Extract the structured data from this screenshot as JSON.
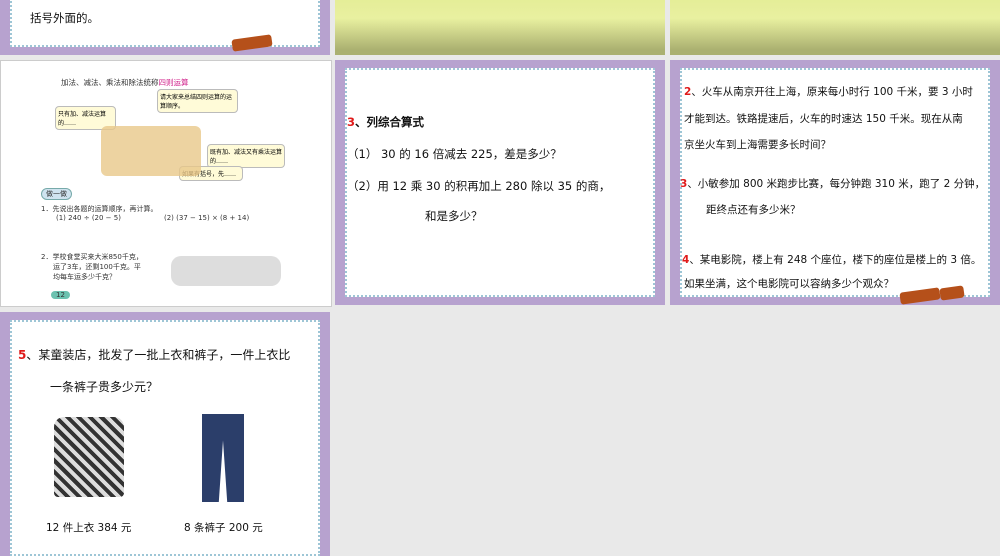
{
  "slides": [
    {
      "text": "括号外面的。"
    },
    {},
    {},
    {
      "title": "加法、减法、乘法和除法统称",
      "highlight": "四则运算",
      "bubbles": [
        "请大家来总结四则运算的运算顺序。",
        "只有加、减法运算的……",
        "既有加、减法又有乘法运算的……",
        "如果有括号，先……"
      ],
      "section": "做一做",
      "q1": "1．先说出各题的运算顺序，再计算。",
      "q1a": "(1) 240 ÷ (20 − 5)",
      "q1b": "(2) (37 − 15) × (8 + 14)",
      "q2": [
        "2．学校食堂买来大米850千克，",
        "运了3车，还剩100千克。平",
        "均每车运多少千克？"
      ],
      "page": "12"
    },
    {
      "heading_num": "3",
      "heading": "、列综合算式",
      "lines": [
        "（1） 30 的 16 倍减去 225，差是多少？",
        "（2）用 12 乘 30 的积再加上 280  除以 35 的商，",
        "和是多少？"
      ]
    },
    {
      "q2_num": "2",
      "q2": [
        "、火车从南京开往上海，原来每小时行 100 千米，要 3 小时",
        "才能到达。铁路提速后，火车的时速达 150 千米。现在从南",
        "京坐火车到上海需要多长时间？"
      ],
      "q3_num": "3",
      "q3": [
        "、小敏参加 800 米跑步比赛，每分钟跑 310 米，跑了 2 分钟，",
        "距终点还有多少米？"
      ],
      "q4_num": "4",
      "q4": [
        "、某电影院，楼上有 248 个座位，楼下的座位是楼上的 3 倍。",
        "如果坐满，这个电影院可以容纳多少个观众？"
      ]
    },
    {
      "q_num": "5",
      "q": [
        "、某童装店，批发了一批上衣和裤子，一件上衣比",
        "一条裤子贵多少元？"
      ],
      "caption1": "12 件上衣 384 元",
      "caption2": "8 条裤子 200 元"
    }
  ]
}
